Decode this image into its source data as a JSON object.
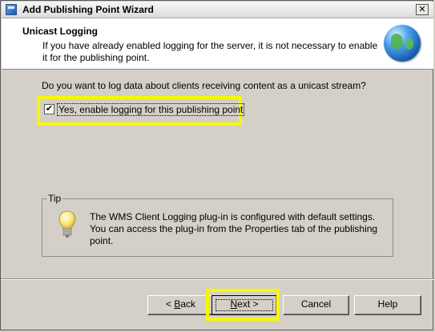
{
  "window": {
    "title": "Add Publishing Point Wizard",
    "close_glyph": "✕"
  },
  "header": {
    "title": "Unicast Logging",
    "subtitle": "If you have already enabled logging for the server, it is not necessary to enable it for the publishing point.",
    "icon": "globe-icon"
  },
  "body": {
    "question": "Do you want to log data about clients receiving content as a unicast stream?",
    "checkbox": {
      "label": "Yes, enable logging for this publishing point",
      "checked": true,
      "check_glyph": "✔"
    }
  },
  "tip": {
    "legend": "Tip",
    "icon": "lightbulb-icon",
    "text": "The WMS Client Logging plug-in is configured with default settings. You can access the plug-in from the Properties tab of the publishing point."
  },
  "buttons": {
    "back": {
      "prefix": "< ",
      "mnemonic": "B",
      "rest": "ack"
    },
    "next": {
      "mnemonic": "N",
      "rest": "ext >"
    },
    "cancel": "Cancel",
    "help": "Help"
  },
  "colors": {
    "highlight": "#f7f700",
    "dialog_bg": "#d4d0c8",
    "header_bg": "#ffffff"
  }
}
